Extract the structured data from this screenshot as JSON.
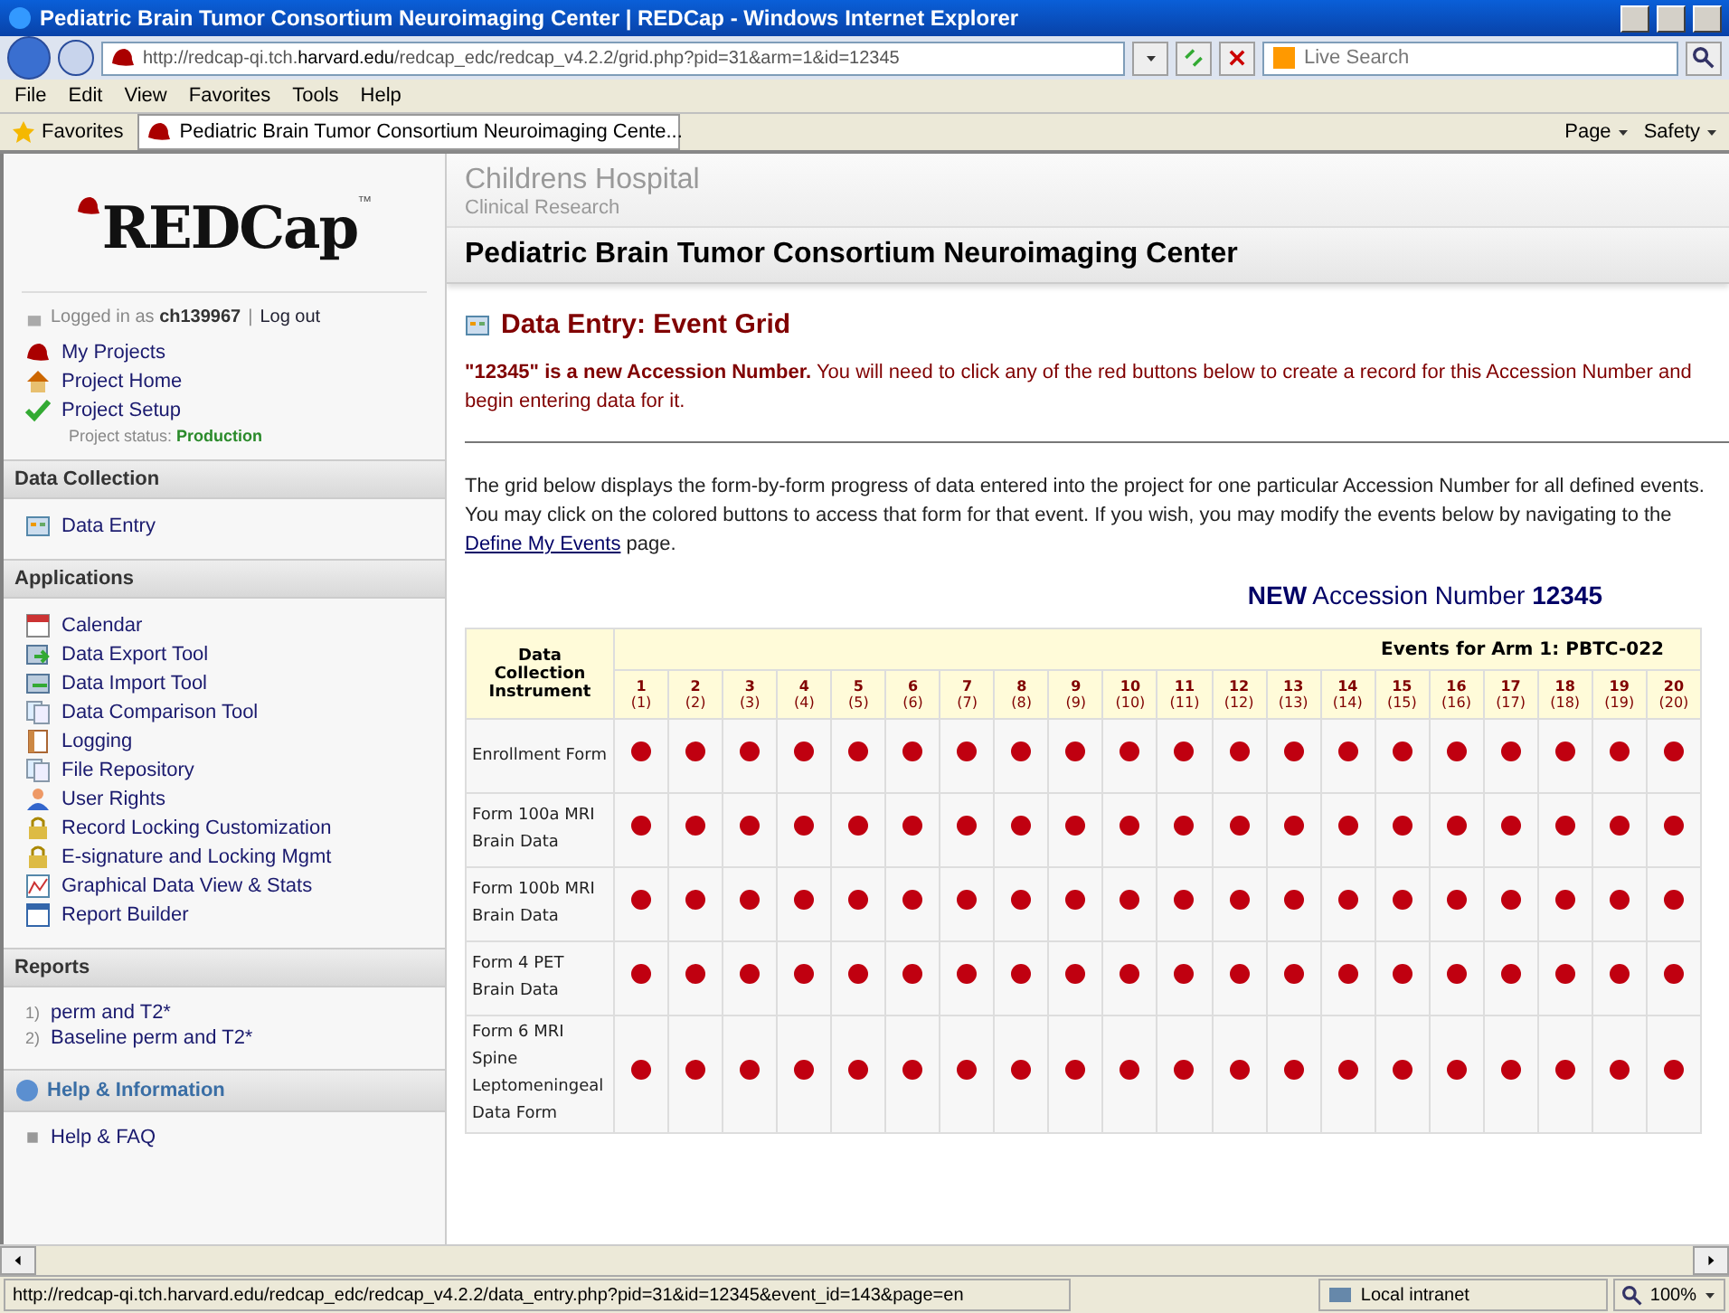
{
  "window": {
    "title": "Pediatric Brain Tumor Consortium Neuroimaging Center | REDCap - Windows Internet Explorer"
  },
  "address_bar": {
    "url_prefix": "http://redcap-qi.tch.",
    "url_host": "harvard.edu",
    "url_path": "/redcap_edc/redcap_v4.2.2/grid.php?pid=31&arm=1&id=12345",
    "search_placeholder": "Live Search"
  },
  "menu": [
    "File",
    "Edit",
    "View",
    "Favorites",
    "Tools",
    "Help"
  ],
  "favorites_bar": {
    "label": "Favorites",
    "tab": "Pediatric Brain Tumor Consortium Neuroimaging Cente...",
    "commands": [
      "Page",
      "Safety"
    ]
  },
  "sidebar": {
    "logo": "REDCap",
    "logo_mark": "™",
    "login": {
      "prefix": "Logged in as",
      "user": "ch139967",
      "separator": "|",
      "logout": "Log out"
    },
    "project_links": [
      {
        "label": "My Projects"
      },
      {
        "label": "Project Home"
      },
      {
        "label": "Project Setup"
      }
    ],
    "status": {
      "label": "Project status:",
      "value": "Production"
    },
    "sections": [
      {
        "title": "Data Collection",
        "kind": "links",
        "items": [
          {
            "label": "Data Entry"
          }
        ]
      },
      {
        "title": "Applications",
        "kind": "links",
        "items": [
          {
            "label": "Calendar"
          },
          {
            "label": "Data Export Tool"
          },
          {
            "label": "Data Import Tool"
          },
          {
            "label": "Data Comparison Tool"
          },
          {
            "label": "Logging"
          },
          {
            "label": "File Repository"
          },
          {
            "label": "User Rights"
          },
          {
            "label": "Record Locking Customization"
          },
          {
            "label": "E-signature and Locking Mgmt"
          },
          {
            "label": "Graphical Data View & Stats"
          },
          {
            "label": "Report Builder"
          }
        ]
      },
      {
        "title": "Reports",
        "kind": "numbered",
        "items": [
          {
            "number": "1)",
            "label": "perm and T2*"
          },
          {
            "number": "2)",
            "label": "Baseline perm and T2*"
          }
        ]
      },
      {
        "title": "Help & Information",
        "kind": "bullets",
        "items": [
          {
            "label": "Help & FAQ"
          }
        ]
      }
    ]
  },
  "header": {
    "institution": "Childrens Hospital",
    "subtitle": "Clinical Research",
    "project": "Pediatric Brain Tumor Consortium Neuroimaging Center"
  },
  "page": {
    "title": "Data Entry: Event Grid",
    "notice": "**\"12345\" is a new Accession Number.** You will need to click any of the red buttons below to create a record for this Accession Number and begin entering data for it.",
    "intro_before": "The grid below displays the form-by-form progress of data entered into the project for one particular Accession Number for all defined events. You may click on the colored buttons to access that form for that event. If you wish, you may modify the events below by navigating to the",
    "intro_link": "Define My Events",
    "intro_after": "page.",
    "record": {
      "new": "NEW",
      "label": "Accession Number",
      "number": "12345"
    }
  },
  "grid": {
    "corner": "Data Collection Instrument",
    "arm": "Events for Arm 1: PBTC-022",
    "events": [
      {
        "n": "1",
        "id": "(1)"
      },
      {
        "n": "2",
        "id": "(2)"
      },
      {
        "n": "3",
        "id": "(3)"
      },
      {
        "n": "4",
        "id": "(4)"
      },
      {
        "n": "5",
        "id": "(5)"
      },
      {
        "n": "6",
        "id": "(6)"
      },
      {
        "n": "7",
        "id": "(7)"
      },
      {
        "n": "8",
        "id": "(8)"
      },
      {
        "n": "9",
        "id": "(9)"
      },
      {
        "n": "10",
        "id": "(10)"
      },
      {
        "n": "11",
        "id": "(11)"
      },
      {
        "n": "12",
        "id": "(12)"
      },
      {
        "n": "13",
        "id": "(13)"
      },
      {
        "n": "14",
        "id": "(14)"
      },
      {
        "n": "15",
        "id": "(15)"
      },
      {
        "n": "16",
        "id": "(16)"
      },
      {
        "n": "17",
        "id": "(17)"
      },
      {
        "n": "18",
        "id": "(18)"
      },
      {
        "n": "19",
        "id": "(19)"
      },
      {
        "n": "20",
        "id": "(20)"
      }
    ],
    "rows": [
      {
        "form": "Enrollment Form"
      },
      {
        "form": "Form 100a MRI Brain Data"
      },
      {
        "form": "Form 100b MRI Brain Data"
      },
      {
        "form": "Form 4 PET Brain Data"
      },
      {
        "form": "Form 6 MRI Spine Leptomeningeal Data Form"
      }
    ]
  },
  "status_bar": {
    "url": "http://redcap-qi.tch.harvard.edu/redcap_edc/redcap_v4.2.2/data_entry.php?pid=31&id=12345&event_id=143&page=en",
    "zone": "Local intranet",
    "zoom": "100%"
  }
}
